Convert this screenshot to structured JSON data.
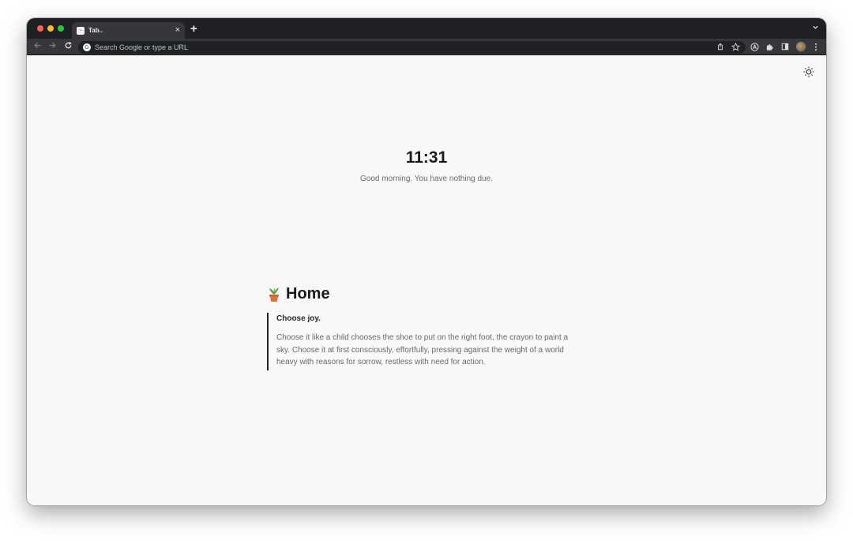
{
  "browser": {
    "tab": {
      "title": "Tab..",
      "favicon": "~"
    },
    "new_tab_label": "+",
    "close_label": "×",
    "omnibox": {
      "placeholder": "Search Google or type a URL"
    }
  },
  "page": {
    "clock": "11:31",
    "greeting": "Good morning. You have nothing due.",
    "section": {
      "emoji": "potted-plant",
      "title": "Home",
      "quote": {
        "title": "Choose joy.",
        "body": "Choose it like a child chooses the shoe to put on the right foot, the crayon to paint a sky. Choose it at first consciously, effortfully, pressing against the weight of a world heavy with reasons for sorrow, restless with need for action."
      }
    }
  },
  "colors": {
    "page_background": "#f9f7f8",
    "tab_bar": "#1f2023",
    "toolbar": "#36373b",
    "text_primary": "#1a1a1a",
    "text_muted": "#6b6b6b"
  }
}
